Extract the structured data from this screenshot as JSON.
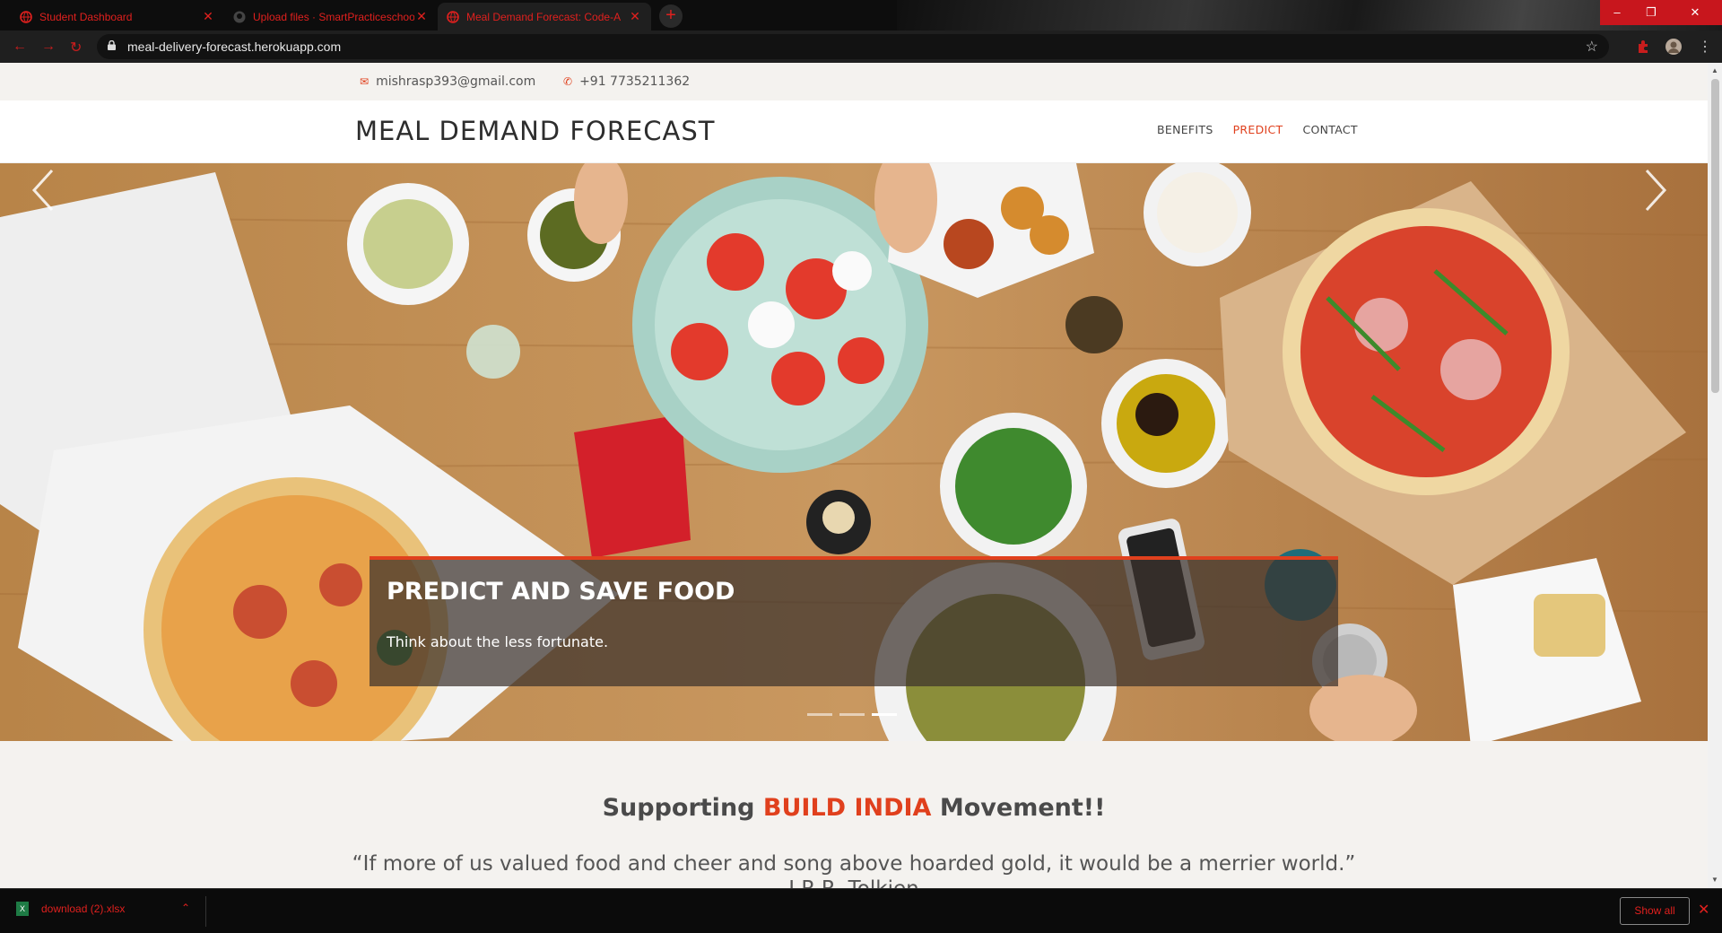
{
  "browser": {
    "tabs": [
      {
        "title": "Student Dashboard",
        "active": false
      },
      {
        "title": "Upload files · SmartPracticeschool",
        "active": false
      },
      {
        "title": "Meal Demand Forecast: Code-A",
        "active": true
      }
    ],
    "new_tab": "+",
    "url": "meal-delivery-forecast.herokuapp.com",
    "window_controls": {
      "minimize": "–",
      "restore": "❐",
      "close": "✕"
    }
  },
  "topbar": {
    "email": "mishrasp393@gmail.com",
    "phone": "+91 7735211362"
  },
  "header": {
    "brand": "MEAL DEMAND FORECAST",
    "nav": [
      {
        "label": "BENEFITS",
        "active": false
      },
      {
        "label": "PREDICT",
        "active": true
      },
      {
        "label": "CONTACT",
        "active": false
      }
    ]
  },
  "hero": {
    "caption_title": "PREDICT AND SAVE FOOD",
    "caption_text": "Think about the less fortunate.",
    "slides": 3,
    "active_slide": 3
  },
  "movement": {
    "prefix": "Supporting ",
    "highlight": "BUILD INDIA",
    "suffix": " Movement!!"
  },
  "quote": {
    "text": "“If more of us valued food and cheer and song above hoarded gold, it would be a merrier world.”",
    "author": "J.R.R. Tolkien"
  },
  "downloads": {
    "file": "download (2).xlsx",
    "show_all": "Show all"
  },
  "colors": {
    "accent": "#e0401d",
    "browser_accent": "#e0201e"
  }
}
